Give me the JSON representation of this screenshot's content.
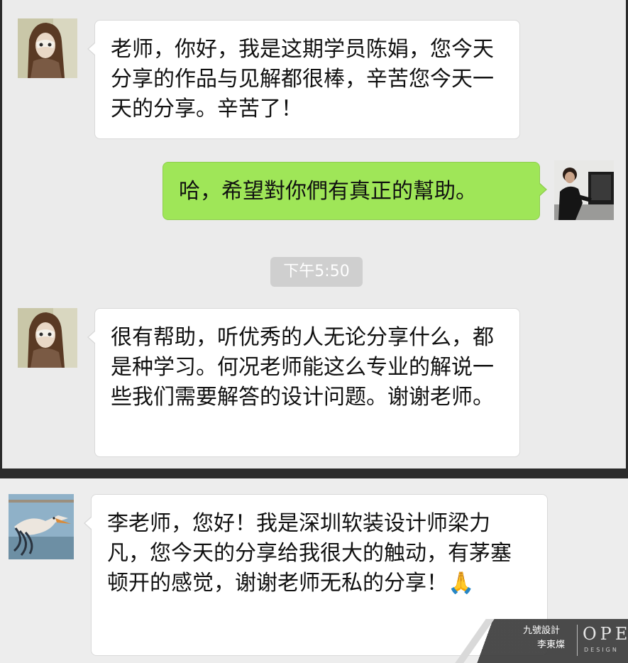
{
  "messages": [
    {
      "sender": "incoming",
      "avatar": "woman-with-mask-avatar",
      "text": "老师，你好，我是这期学员陈娟，您今天分享的作品与见解都很棒，辛苦您今天一天的分享。辛苦了！"
    },
    {
      "sender": "outgoing",
      "avatar": "man-at-computer-avatar",
      "text": "哈，希望對你們有真正的幫助。"
    },
    {
      "sender": "incoming",
      "avatar": "woman-with-mask-avatar",
      "text": "很有帮助，听优秀的人无论分享什么，都是种学习。何况老师能这么专业的解说一些我们需要解答的设计问题。谢谢老师。"
    },
    {
      "sender": "incoming",
      "avatar": "pelican-avatar",
      "text": "李老师，您好！我是深圳软装设计师梁力凡，您今天的分享给我很大的触动，有茅塞顿开的感觉，谢谢老师无私的分享！🙏"
    }
  ],
  "timestamp": "下午5:50",
  "watermark": {
    "line1": "九號設計",
    "line2": "李東燦",
    "brand": "OPEN",
    "sub": "DESIGN"
  },
  "colors": {
    "background": "#ebebeb",
    "incoming_bubble": "#ffffff",
    "outgoing_bubble": "#9fe658",
    "divider": "#2b2b2b"
  }
}
